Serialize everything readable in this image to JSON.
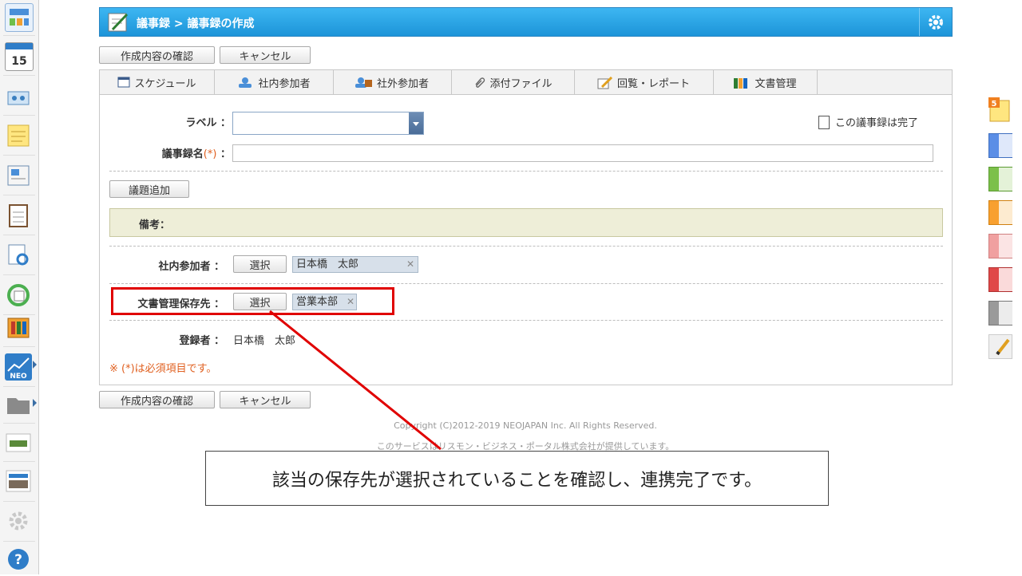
{
  "header": {
    "title": "議事録 > 議事録の作成"
  },
  "actions": {
    "confirm_label": "作成内容の確認",
    "cancel_label": "キャンセル"
  },
  "tabs": [
    {
      "label": "スケジュール",
      "icon": "calendar-icon"
    },
    {
      "label": "社内参加者",
      "icon": "user-icon"
    },
    {
      "label": "社外参加者",
      "icon": "external-user-icon"
    },
    {
      "label": "添付ファイル",
      "icon": "paperclip-icon"
    },
    {
      "label": "回覧・レポート",
      "icon": "edit-icon"
    },
    {
      "label": "文書管理",
      "icon": "binder-icon"
    }
  ],
  "form": {
    "label_field": "ラベル ：",
    "complete_checkbox": "この議事録は完了",
    "name_field": "議事録名",
    "required_mark": "(*)",
    "colon": "：",
    "add_topic_label": "議題追加",
    "remarks_label": "備考：",
    "internal_participants_label": "社内参加者 ：",
    "select_label": "選択",
    "internal_participant": "日本橋　太郎",
    "doc_storage_label": "文書管理保存先 ：",
    "doc_storage_value": "営業本部",
    "registrant_label": "登録者 ：",
    "registrant_value": "日本橋　太郎",
    "required_note": "※ (*)は必須項目です。"
  },
  "footer": {
    "copyright": "Copyright (C)2012-2019 NEOJAPAN Inc. All Rights Reserved.",
    "provider": "このサービスはリスモン・ビジネス・ポータル株式会社が提供しています。"
  },
  "callout": {
    "text": "該当の保存先が選択されていることを確認し、連携完了です。"
  },
  "colors": {
    "header": "#1c94d8",
    "callout": "#e00000",
    "remarks_bg": "#eeeed8"
  }
}
